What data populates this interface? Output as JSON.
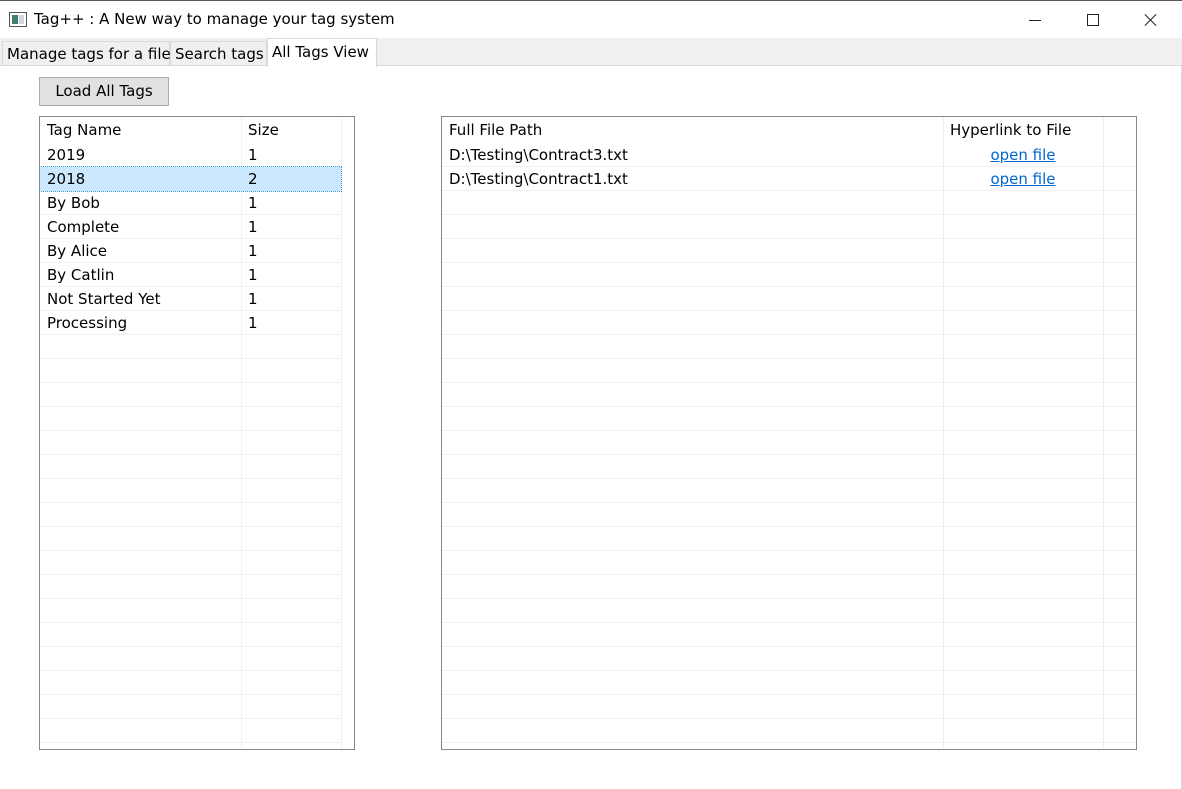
{
  "window": {
    "title": "Tag++ : A New way to manage your tag system"
  },
  "tabs": [
    {
      "label": "Manage tags for a file"
    },
    {
      "label": "Search tags"
    },
    {
      "label": "All Tags View"
    }
  ],
  "toolbar": {
    "load_label": "Load All Tags"
  },
  "tags_table": {
    "columns": [
      "Tag Name",
      "Size"
    ],
    "rows": [
      {
        "name": "2019",
        "size": "1"
      },
      {
        "name": "2018",
        "size": "2"
      },
      {
        "name": "By Bob",
        "size": "1"
      },
      {
        "name": "Complete",
        "size": "1"
      },
      {
        "name": "By Alice",
        "size": "1"
      },
      {
        "name": "By Catlin",
        "size": "1"
      },
      {
        "name": "Not Started Yet",
        "size": "1"
      },
      {
        "name": "Processing",
        "size": "1"
      }
    ],
    "selected_index": 1
  },
  "files_table": {
    "columns": [
      "Full File Path",
      "Hyperlink to File"
    ],
    "rows": [
      {
        "path": "D:\\Testing\\Contract3.txt",
        "link": "open file"
      },
      {
        "path": "D:\\Testing\\Contract1.txt",
        "link": "open file"
      }
    ]
  },
  "colors": {
    "selection": "#cce8ff",
    "link": "#0066cc",
    "grid_line": "#f0f0f0"
  }
}
